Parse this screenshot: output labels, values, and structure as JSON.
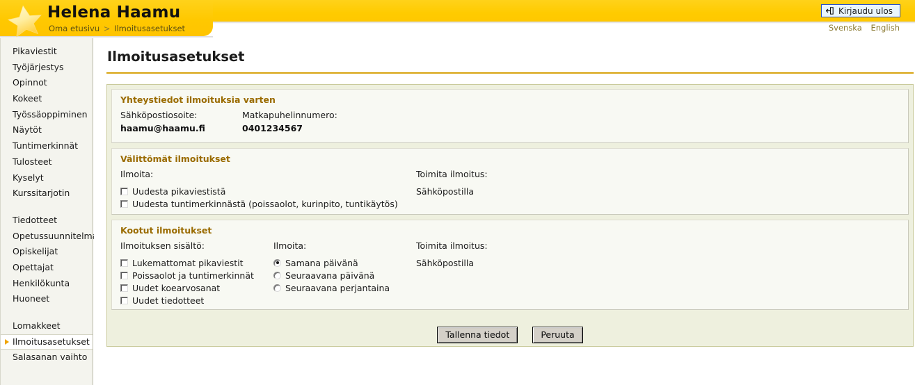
{
  "header": {
    "user_name": "Helena Haamu",
    "breadcrumb_home": "Oma etusivu",
    "breadcrumb_sep": ">",
    "breadcrumb_current": "Ilmoitusasetukset",
    "logout_label": "Kirjaudu ulos",
    "logout_icon": "exit-arrow-icon",
    "star_icon": "star-logo-icon",
    "languages": [
      "Svenska",
      "English"
    ],
    "accent_yellow": "#ffc800",
    "logout_border": "#2a52c8"
  },
  "sidebar": {
    "groups": [
      {
        "items": [
          {
            "label": "Pikaviestit",
            "active": false
          },
          {
            "label": "Työjärjestys",
            "active": false
          },
          {
            "label": "Opinnot",
            "active": false
          },
          {
            "label": "Kokeet",
            "active": false
          },
          {
            "label": "Työssäoppiminen",
            "active": false
          },
          {
            "label": "Näytöt",
            "active": false
          },
          {
            "label": "Tuntimerkinnät",
            "active": false
          },
          {
            "label": "Tulosteet",
            "active": false
          },
          {
            "label": "Kyselyt",
            "active": false
          },
          {
            "label": "Kurssitarjotin",
            "active": false
          }
        ]
      },
      {
        "items": [
          {
            "label": "Tiedotteet",
            "active": false
          },
          {
            "label": "Opetussuunnitelma",
            "active": false
          },
          {
            "label": "Opiskelijat",
            "active": false
          },
          {
            "label": "Opettajat",
            "active": false
          },
          {
            "label": "Henkilökunta",
            "active": false
          },
          {
            "label": "Huoneet",
            "active": false
          }
        ]
      },
      {
        "items": [
          {
            "label": "Lomakkeet",
            "active": false
          },
          {
            "label": "Ilmoitusasetukset",
            "active": true
          },
          {
            "label": "Salasanan vaihto",
            "active": false
          }
        ]
      }
    ]
  },
  "main": {
    "page_title": "Ilmoitusasetukset",
    "contact_section": {
      "title": "Yhteystiedot ilmoituksia varten",
      "email_label": "Sähköpostiosoite:",
      "email_value": "haamu@haamu.fi",
      "phone_label": "Matkapuhelinnumero:",
      "phone_value": "0401234567"
    },
    "immediate_section": {
      "title": "Välittömät ilmoitukset",
      "notify_label": "Ilmoita:",
      "deliver_label": "Toimita ilmoitus:",
      "deliver_value": "Sähköpostilla",
      "options": [
        {
          "label": "Uudesta pikaviestistä",
          "checked": false
        },
        {
          "label": "Uudesta tuntimerkinnästä (poissaolot, kurinpito, tuntikäytös)",
          "checked": false
        }
      ]
    },
    "digest_section": {
      "title": "Kootut ilmoitukset",
      "content_label": "Ilmoituksen sisältö:",
      "notify_label": "Ilmoita:",
      "deliver_label": "Toimita ilmoitus:",
      "deliver_value": "Sähköpostilla",
      "content_options": [
        {
          "label": "Lukemattomat pikaviestit",
          "checked": false
        },
        {
          "label": "Poissaolot ja tuntimerkinnät",
          "checked": false
        },
        {
          "label": "Uudet koearvosanat",
          "checked": false
        },
        {
          "label": "Uudet tiedotteet",
          "checked": false
        }
      ],
      "timing_options": [
        {
          "label": "Samana päivänä",
          "selected": true
        },
        {
          "label": "Seuraavana päivänä",
          "selected": false
        },
        {
          "label": "Seuraavana perjantaina",
          "selected": false
        }
      ]
    },
    "buttons": {
      "save_label": "Tallenna tiedot",
      "cancel_label": "Peruuta"
    }
  }
}
